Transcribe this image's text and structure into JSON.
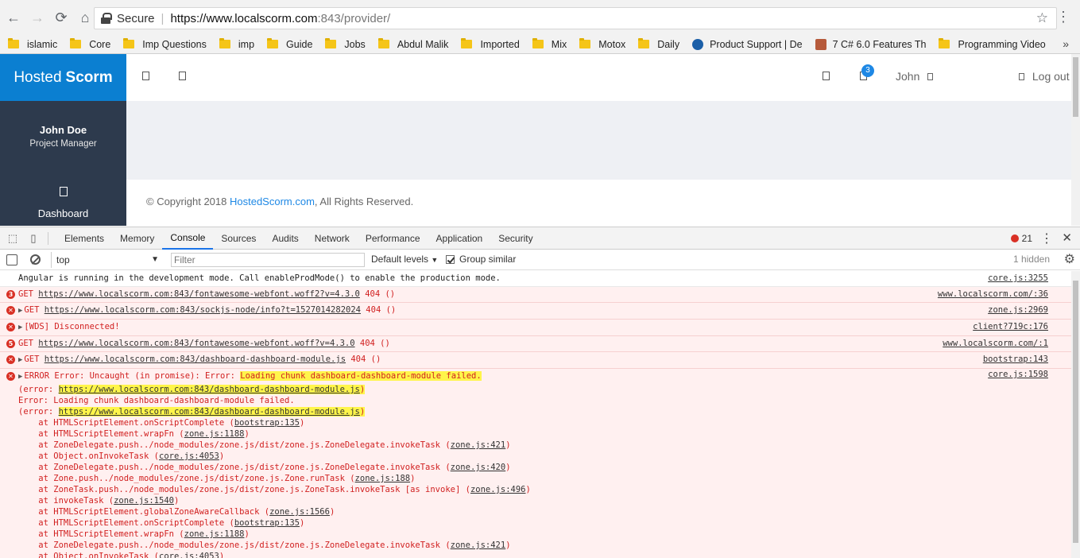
{
  "browser": {
    "secure_label": "Secure",
    "url_host": "https://www.localscorm.com",
    "url_path": ":843/provider/",
    "bookmarks": [
      {
        "label": "islamic",
        "icon": "folder-icon"
      },
      {
        "label": "Core",
        "icon": "folder-icon"
      },
      {
        "label": "Imp Questions",
        "icon": "folder-icon"
      },
      {
        "label": "imp",
        "icon": "folder-icon"
      },
      {
        "label": "Guide",
        "icon": "folder-icon"
      },
      {
        "label": "Jobs",
        "icon": "folder-icon"
      },
      {
        "label": "Abdul Malik",
        "icon": "folder-icon"
      },
      {
        "label": "Imported",
        "icon": "folder-icon"
      },
      {
        "label": "Mix",
        "icon": "folder-icon"
      },
      {
        "label": "Motox",
        "icon": "folder-icon"
      },
      {
        "label": "Daily",
        "icon": "folder-icon"
      },
      {
        "label": "Product Support | De",
        "icon": "dell-favicon"
      },
      {
        "label": "7 C# 6.0 Features Th",
        "icon": "person-favicon"
      },
      {
        "label": "Programming Video",
        "icon": "folder-icon"
      }
    ],
    "more_label": "»"
  },
  "app": {
    "brand_light": "Hosted",
    "brand_bold": "Scorm",
    "notification_count": "3",
    "user_name": "John",
    "logout_label": "Log out",
    "sidebar": {
      "name": "John Doe",
      "role": "Project Manager",
      "dashboard_label": "Dashboard"
    },
    "footer": {
      "prefix": "© Copyright 2018 ",
      "link": "HostedScorm.com",
      "suffix": ", All Rights Reserved."
    }
  },
  "devtools": {
    "tabs": [
      "Elements",
      "Memory",
      "Console",
      "Sources",
      "Audits",
      "Network",
      "Performance",
      "Application",
      "Security"
    ],
    "active_tab": "Console",
    "error_count": "21",
    "context": "top",
    "filter_placeholder": "Filter",
    "levels_label": "Default levels",
    "group_similar_label": "Group similar",
    "hidden_label": "1 hidden",
    "colors": {
      "accent": "#1a73e8",
      "error": "#d12020",
      "error_bg": "#fff0f0",
      "highlight": "#fff54a",
      "brand": "#0b7fd1",
      "sidebar": "#2d3a4d"
    }
  },
  "console": {
    "rows": [
      {
        "type": "info",
        "text": "Angular is running in the development mode. Call enableProdMode() to enable the production mode.",
        "source": "core.js:3255"
      },
      {
        "type": "error",
        "count": "3",
        "prefix": "GET ",
        "url": "https://www.localscorm.com:843/fontawesome-webfont.woff2?v=4.3.0",
        "suffix": " 404 ()",
        "source": "www.localscorm.com/:36"
      },
      {
        "type": "error",
        "expand": "true",
        "prefix": "GET ",
        "url": "https://www.localscorm.com:843/sockjs-node/info?t=1527014282024",
        "suffix": " 404 ()",
        "source": "zone.js:2969"
      },
      {
        "type": "error",
        "expand": "true",
        "prefix": "[WDS] Disconnected!",
        "url": "",
        "suffix": "",
        "source": "client?719c:176"
      },
      {
        "type": "error",
        "count": "5",
        "prefix": "GET ",
        "url": "https://www.localscorm.com:843/fontawesome-webfont.woff?v=4.3.0",
        "suffix": " 404 ()",
        "source": "www.localscorm.com/:1"
      },
      {
        "type": "error",
        "expand": "true",
        "prefix": "GET ",
        "url": "https://www.localscorm.com:843/dashboard-dashboard-module.js",
        "suffix": " 404 ()",
        "source": "bootstrap:143"
      }
    ],
    "error_block": {
      "source": "core.js:1598",
      "line1_prefix": "ERROR Error: Uncaught (in promise): Error: ",
      "line1_highlight": "Loading chunk dashboard-dashboard-module failed.",
      "line2_prefix": "(error: ",
      "line2_url": "https://www.localscorm.com:843/dashboard-dashboard-module.js",
      "line2_suffix": ")",
      "line3_text": "Error: Loading chunk dashboard-dashboard-module failed.",
      "line4_prefix": "(error: ",
      "line4_url": "https://www.localscorm.com:843/dashboard-dashboard-module.js",
      "line4_suffix": ")",
      "stack": [
        {
          "text": "    at HTMLScriptElement.onScriptComplete (",
          "link": "bootstrap:135",
          "end": ")"
        },
        {
          "text": "    at HTMLScriptElement.wrapFn (",
          "link": "zone.js:1188",
          "end": ")"
        },
        {
          "text": "    at ZoneDelegate.push../node_modules/zone.js/dist/zone.js.ZoneDelegate.invokeTask (",
          "link": "zone.js:421",
          "end": ")"
        },
        {
          "text": "    at Object.onInvokeTask (",
          "link": "core.js:4053",
          "end": ")"
        },
        {
          "text": "    at ZoneDelegate.push../node_modules/zone.js/dist/zone.js.ZoneDelegate.invokeTask (",
          "link": "zone.js:420",
          "end": ")"
        },
        {
          "text": "    at Zone.push../node_modules/zone.js/dist/zone.js.Zone.runTask (",
          "link": "zone.js:188",
          "end": ")"
        },
        {
          "text": "    at ZoneTask.push../node_modules/zone.js/dist/zone.js.ZoneTask.invokeTask [as invoke] (",
          "link": "zone.js:496",
          "end": ")"
        },
        {
          "text": "    at invokeTask (",
          "link": "zone.js:1540",
          "end": ")"
        },
        {
          "text": "    at HTMLScriptElement.globalZoneAwareCallback (",
          "link": "zone.js:1566",
          "end": ")"
        },
        {
          "text": "    at HTMLScriptElement.onScriptComplete (",
          "link": "bootstrap:135",
          "end": ")"
        },
        {
          "text": "    at HTMLScriptElement.wrapFn (",
          "link": "zone.js:1188",
          "end": ")"
        },
        {
          "text": "    at ZoneDelegate.push../node_modules/zone.js/dist/zone.js.ZoneDelegate.invokeTask (",
          "link": "zone.js:421",
          "end": ")"
        },
        {
          "text": "    at Object.onInvokeTask (",
          "link": "core.js:4053",
          "end": ")"
        }
      ]
    }
  }
}
